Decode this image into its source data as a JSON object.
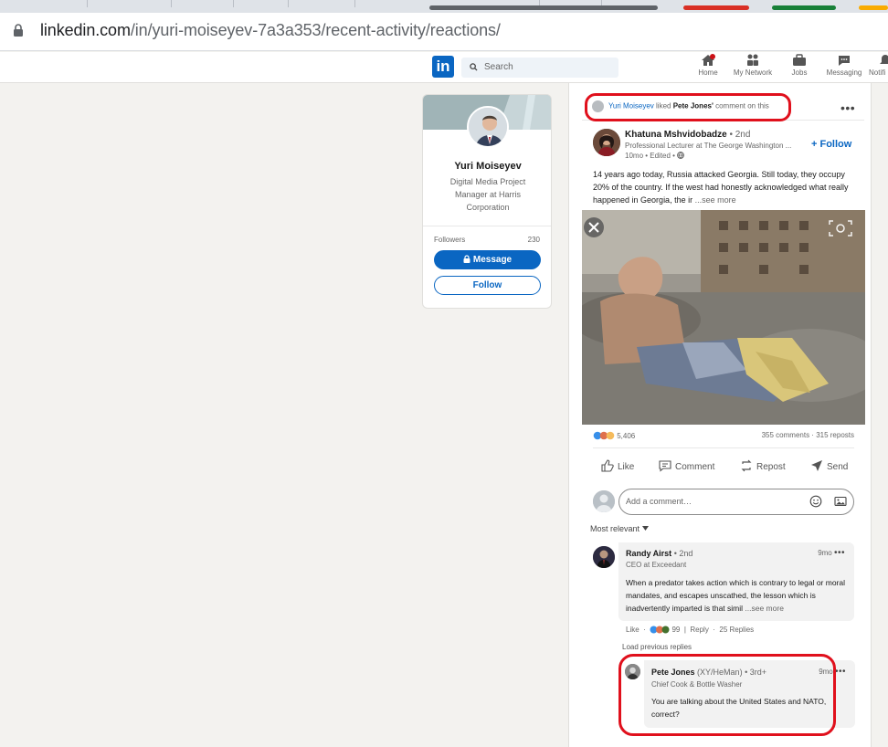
{
  "browser": {
    "url_host": "linkedin.com",
    "url_path": "/in/yuri-moiseyev-7a3a353/recent-activity/reactions/"
  },
  "nav": {
    "search_placeholder": "Search",
    "items": [
      {
        "label": "Home",
        "icon": "home-icon"
      },
      {
        "label": "My Network",
        "icon": "network-icon"
      },
      {
        "label": "Jobs",
        "icon": "briefcase-icon"
      },
      {
        "label": "Messaging",
        "icon": "messaging-icon"
      },
      {
        "label": "Notifi",
        "icon": "bell-icon"
      }
    ]
  },
  "profile": {
    "name": "Yuri Moiseyev",
    "headline": "Digital Media Project Manager at Harris Corporation",
    "followers_label": "Followers",
    "followers_count": "230",
    "message_label": "Message",
    "follow_label": "Follow"
  },
  "post": {
    "header": {
      "actor": "Yuri Moiseyev",
      "verb": "liked",
      "target": "Pete Jones'",
      "suffix": "comment on this"
    },
    "author": {
      "name": "Khatuna Mshvidobadze",
      "degree": "• 2nd",
      "title": "Professional Lecturer at The George Washington ...",
      "meta": "10mo • Edited •",
      "follow_label": "+ Follow"
    },
    "text": "14 years ago today, Russia attacked Georgia. Still today, they occupy 20% of the country. If the west had honestly acknowledged what really happened in Georgia, the ir",
    "see_more": "...see more",
    "reactions_count": "5,406",
    "comments_reposts": "355 comments · 315 reposts",
    "actions": {
      "like": "Like",
      "comment": "Comment",
      "repost": "Repost",
      "send": "Send"
    },
    "comment_placeholder": "Add a comment…",
    "sort_label": "Most relevant"
  },
  "comments": [
    {
      "name": "Randy Airst",
      "degree": "• 2nd",
      "title": "CEO at Exceedant",
      "time": "9mo",
      "text": "When a predator takes action which is contrary to legal or moral mandates, and escapes unscathed, the lesson which is inadvertently imparted is that simil",
      "see_more": "...see more",
      "like_label": "Like",
      "reaction_count": "99",
      "reply_label": "Reply",
      "replies_label": "25 Replies"
    }
  ],
  "load_previous": "Load previous replies",
  "reply": {
    "name": "Pete Jones",
    "pronouns": "(XY/HeMan)",
    "degree": "• 3rd+",
    "title": "Chief Cook & Bottle Washer",
    "time": "9mo",
    "text": "You are talking about the United States and NATO, correct?"
  },
  "colors": {
    "brand": "#0a66c2",
    "highlight": "#e0101c",
    "page_bg": "#f3f2ef"
  }
}
